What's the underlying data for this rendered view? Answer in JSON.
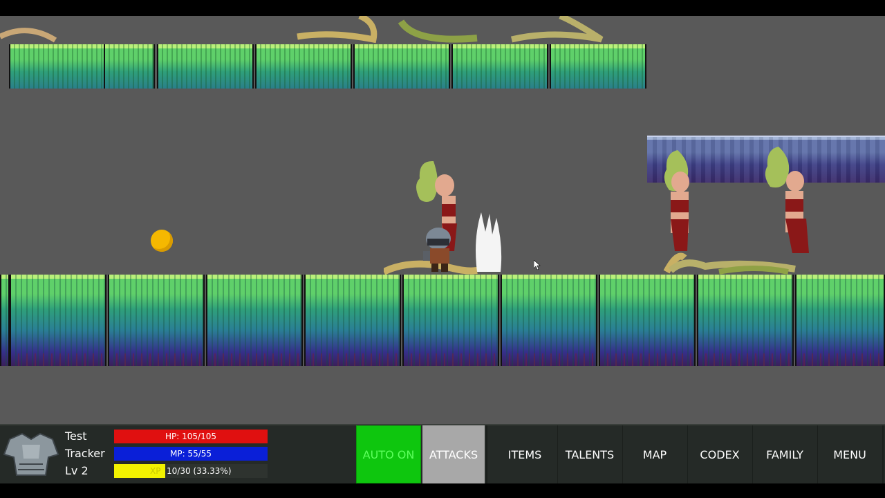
{
  "player": {
    "name_line1": "Test",
    "name_line2": "Tracker",
    "level": "Lv 2",
    "hp": {
      "text": "HP: 105/105",
      "fraction": 1.0,
      "color": "#e01010"
    },
    "mp": {
      "text": "MP: 55/55",
      "fraction": 1.0,
      "color": "#0a1fd8"
    },
    "xp": {
      "tag": "XP",
      "text": "10/30 (33.33%)",
      "fraction": 0.3333,
      "color": "#f2f200"
    },
    "portrait_icon": "armor-chestplate-icon"
  },
  "menu": {
    "auto": {
      "label": "AUTO ON",
      "color": "#0ec60e",
      "text_color": "#5dff5d"
    },
    "attacks": {
      "label": "ATTACKS",
      "color": "#a8a8a8"
    },
    "items": "ITEMS",
    "talents": "TALENTS",
    "map": "MAP",
    "codex": "CODEX",
    "family": "FAMILY",
    "menu": "MENU"
  },
  "scene": {
    "background_color": "#595959",
    "coin_icon": "gold-coin-icon",
    "enemies": [
      "medusa",
      "medusa",
      "medusa"
    ],
    "effect": "slash-effect"
  }
}
